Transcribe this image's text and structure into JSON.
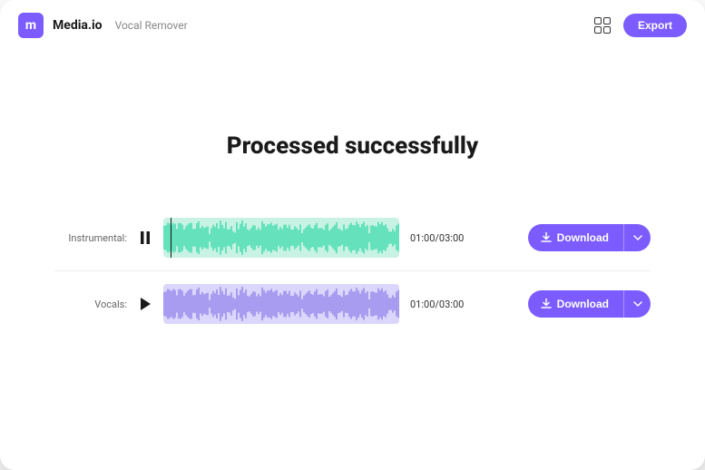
{
  "header": {
    "brand": "Media.io",
    "breadcrumb": "Vocal Remover",
    "export_label": "Export"
  },
  "title": "Processed successfully",
  "tracks": {
    "instrumental": {
      "label": "Instrumental:",
      "time": "01:00/03:00",
      "download_label": "Download",
      "color_bg": "#c8f2e3",
      "color_wave": "#30d9a6",
      "playing": true
    },
    "vocals": {
      "label": "Vocals:",
      "time": "01:00/03:00",
      "download_label": "Download",
      "color_bg": "#dbd6fb",
      "color_wave": "#8c7dea",
      "playing": false
    }
  }
}
